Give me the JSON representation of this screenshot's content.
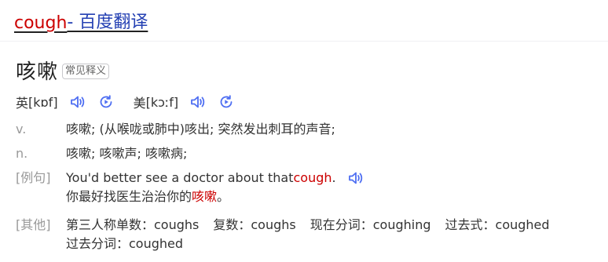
{
  "title": {
    "keyword": "cough",
    "suffix": " - 百度翻译"
  },
  "entry": {
    "word": "咳嗽",
    "tag": "常见释义"
  },
  "pronunciation": {
    "uk_label": "英",
    "uk_ipa": "[kɒf]",
    "us_label": "美",
    "us_ipa": "[kɔːf]"
  },
  "definitions": [
    {
      "pos": "v.",
      "text": "咳嗽; (从喉咙或肺中)咳出; 突然发出刺耳的声音;"
    },
    {
      "pos": "n.",
      "text": "咳嗽; 咳嗽声; 咳嗽病;"
    }
  ],
  "example": {
    "label": "[例句]",
    "en_before": "You'd better see a doctor about that ",
    "en_highlight": "cough",
    "en_after": ".",
    "zh_before": "你最好找医生治治你的",
    "zh_highlight": "咳嗽",
    "zh_after": "。"
  },
  "other": {
    "label": "[其他]",
    "line1": [
      "第三人称单数：coughs",
      "复数：coughs",
      "现在分词：coughing",
      "过去式：coughed"
    ],
    "line2": "过去分词：coughed"
  },
  "colors": {
    "accent_blue": "#4e6ef2",
    "highlight_red": "#cc0000",
    "title_blue": "#2440b3"
  },
  "icons": [
    "speaker-icon",
    "replay-icon"
  ]
}
